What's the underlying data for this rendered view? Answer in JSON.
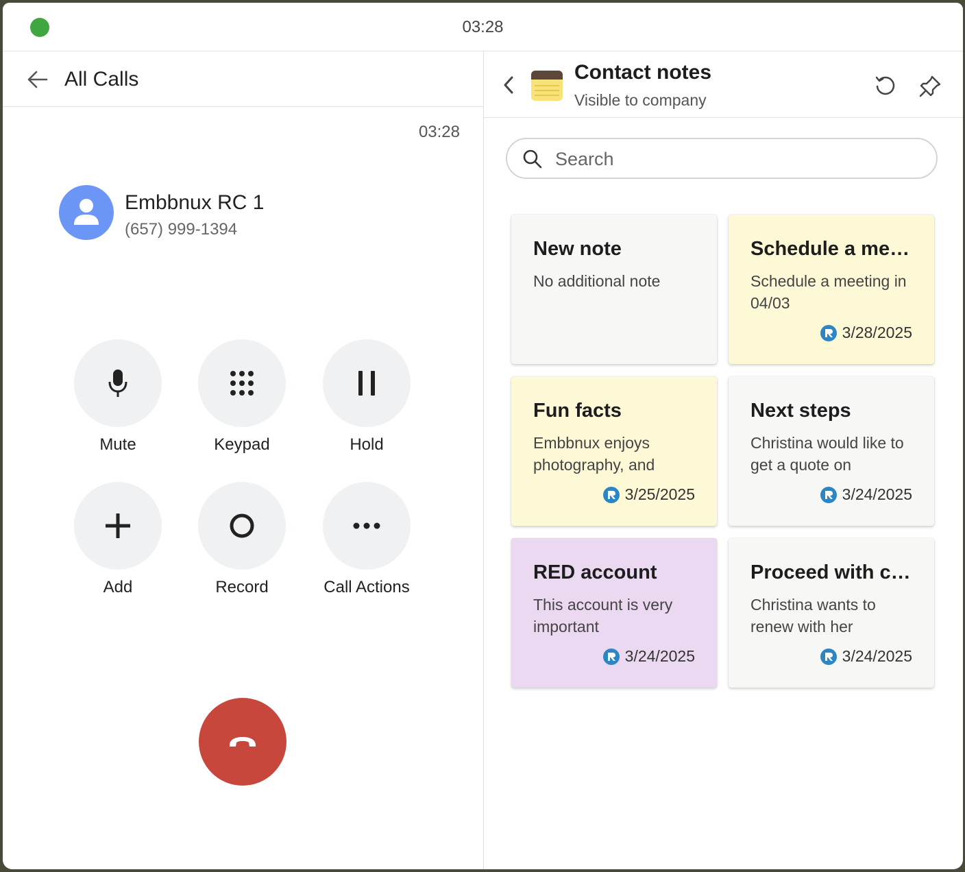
{
  "titlebar": {
    "time": "03:28"
  },
  "call": {
    "nav_title": "All Calls",
    "timer": "03:28",
    "contact_name": "Embbnux RC 1",
    "contact_phone": "(657) 999-1394",
    "controls": [
      {
        "label": "Mute",
        "icon": "microphone-icon"
      },
      {
        "label": "Keypad",
        "icon": "keypad-icon"
      },
      {
        "label": "Hold",
        "icon": "pause-icon"
      },
      {
        "label": "Add",
        "icon": "plus-icon"
      },
      {
        "label": "Record",
        "icon": "record-icon"
      },
      {
        "label": "Call Actions",
        "icon": "more-horizontal-icon"
      }
    ],
    "hangup_icon": "hang-up-icon"
  },
  "notes_panel": {
    "title": "Contact notes",
    "subtitle": "Visible to company",
    "search_placeholder": "Search",
    "notes": [
      {
        "title": "New note",
        "body": "No additional note",
        "date": "",
        "color": "#f7f7f6"
      },
      {
        "title": "Schedule a mee...",
        "body": "Schedule a meeting in 04/03",
        "date": "3/28/2025",
        "color": "#fdf8d6"
      },
      {
        "title": "Fun facts",
        "body": "Embbnux enjoys photography, and",
        "date": "3/25/2025",
        "color": "#fdf8d6"
      },
      {
        "title": "Next steps",
        "body": "Christina would like to get a quote on",
        "date": "3/24/2025",
        "color": "#f7f7f6"
      },
      {
        "title": "RED account",
        "body": "This account is very important",
        "date": "3/24/2025",
        "color": "#ead9f1"
      },
      {
        "title": "Proceed with ca...",
        "body": "Christina wants to renew with her",
        "date": "3/24/2025",
        "color": "#f7f7f6"
      }
    ]
  },
  "colors": {
    "status": "#3fa642",
    "avatar": "#6b96f5",
    "hangup": "#c8473d",
    "rc_badge": "#2d86c4"
  }
}
